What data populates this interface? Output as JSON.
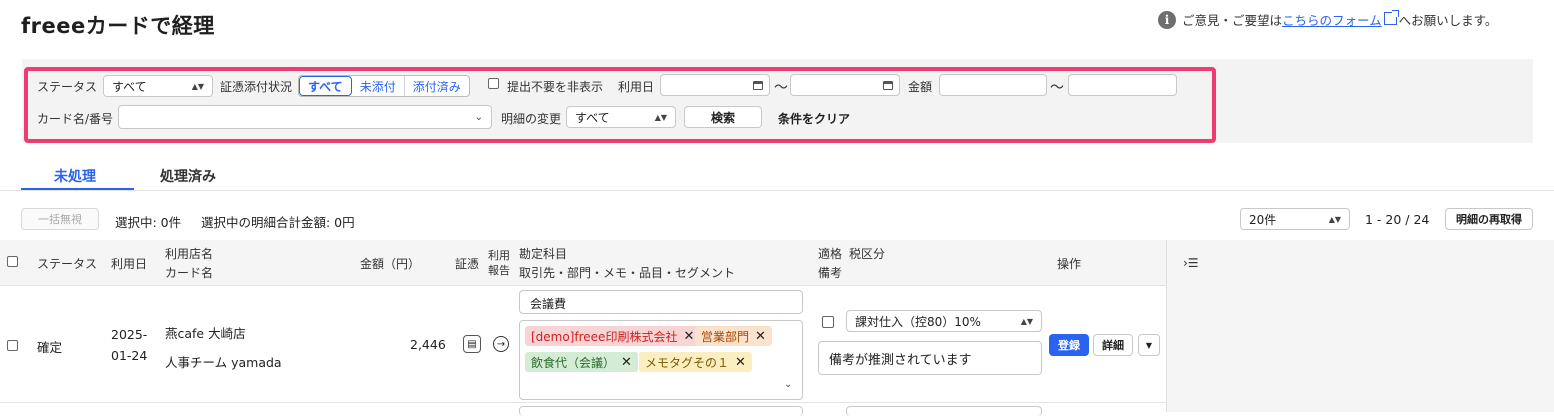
{
  "header": {
    "title": "freeeカードで経理",
    "feedback_prefix": "ご意見・ご要望は",
    "feedback_link": "こちらのフォーム",
    "feedback_suffix": "へお願いします。"
  },
  "filters": {
    "status_label": "ステータス",
    "status_value": "すべて",
    "evidence_label": "証憑添付状況",
    "evidence_options": [
      "すべて",
      "未添付",
      "添付済み"
    ],
    "hide_unneeded_label": "提出不要を非表示",
    "usage_date_label": "利用日",
    "range_sep": "〜",
    "amount_label": "金額",
    "card_label": "カード名/番号",
    "detail_change_label": "明細の変更",
    "detail_change_value": "すべて",
    "search_button": "検索",
    "clear_button": "条件をクリア"
  },
  "tabs": [
    "未処理",
    "処理済み"
  ],
  "toolbar": {
    "bulk_ignore": "一括無視",
    "selected_count": "選択中: 0件",
    "selected_total": "選択中の明細合計金額: 0円",
    "per_page": "20件",
    "pagination": "1 - 20 / 24",
    "refetch": "明細の再取得"
  },
  "table": {
    "headers": {
      "status": "ステータス",
      "usage_date": "利用日",
      "store_name": "利用店名",
      "card_name": "カード名",
      "amount": "金額（円）",
      "evidence": "証憑",
      "usage_report_1": "利用",
      "usage_report_2": "報告",
      "account": "勘定科目",
      "account_sub": "取引先・部門・メモ・品目・セグメント",
      "qualified": "適格",
      "tax": "税区分",
      "memo": "備考",
      "actions": "操作"
    },
    "rows": [
      {
        "status": "確定",
        "date_1": "2025-",
        "date_2": "01-24",
        "store": "燕cafe 大崎店",
        "card": "人事チーム yamada",
        "amount": "2,446",
        "account": "会議費",
        "tags": [
          "[demo]freee印刷株式会社",
          "営業部門",
          "飲食代（会議）",
          "メモタグその１"
        ],
        "tax": "課対仕入（控80）10%",
        "memo": "備考が推測されています",
        "register": "登録",
        "detail": "詳細"
      }
    ]
  }
}
